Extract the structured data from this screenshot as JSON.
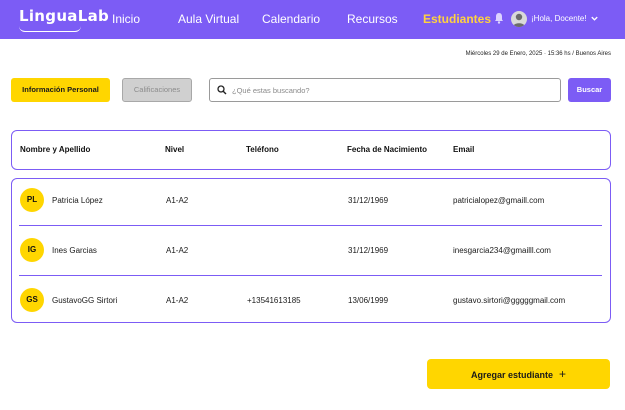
{
  "app": {
    "logo": "LinguaLab"
  },
  "nav": {
    "items": [
      {
        "label": "Inicio"
      },
      {
        "label": "Aula Virtual"
      },
      {
        "label": "Calendario"
      },
      {
        "label": "Recursos"
      },
      {
        "label": "Estudiantes",
        "active": true
      }
    ],
    "greeting": "¡Hola, Docente!",
    "icons": [
      "bell-icon",
      "avatar",
      "chevron-down-icon"
    ]
  },
  "datetime": "Miércoles 29 de Enero, 2025 · 15:36 hs / Buenos Aires",
  "toolbar": {
    "tab_info": "Información Personal",
    "tab_grades": "Calificaciones",
    "search_placeholder": "¿Qué estas buscando?",
    "search_value": "",
    "search_button": "Buscar"
  },
  "table": {
    "columns": [
      "Nombre y Apellido",
      "Nivel",
      "Teléfono",
      "Fecha de Nacimiento",
      "Email"
    ],
    "rows": [
      {
        "initials": "PL",
        "name": "Patricia López",
        "level": "A1-A2",
        "phone": "",
        "birth": "31/12/1969",
        "email": "patricialopez@gmaill.com"
      },
      {
        "initials": "IG",
        "name": "Ines Garcias",
        "level": "A1-A2",
        "phone": "",
        "birth": "31/12/1969",
        "email": "inesgarcia234@gmailll.com"
      },
      {
        "initials": "GS",
        "name": "GustavoGG Sirtori",
        "level": "A1-A2",
        "phone": "+13541613185",
        "birth": "13/06/1999",
        "email": "gustavo.sirtori@gggggmail.com"
      }
    ]
  },
  "actions": {
    "add_student": "Agregar estudiante",
    "add_symbol": "+"
  },
  "colors": {
    "brand_purple": "#7c5cf5",
    "accent_yellow": "#ffd600",
    "active_nav": "#ffd23f"
  }
}
